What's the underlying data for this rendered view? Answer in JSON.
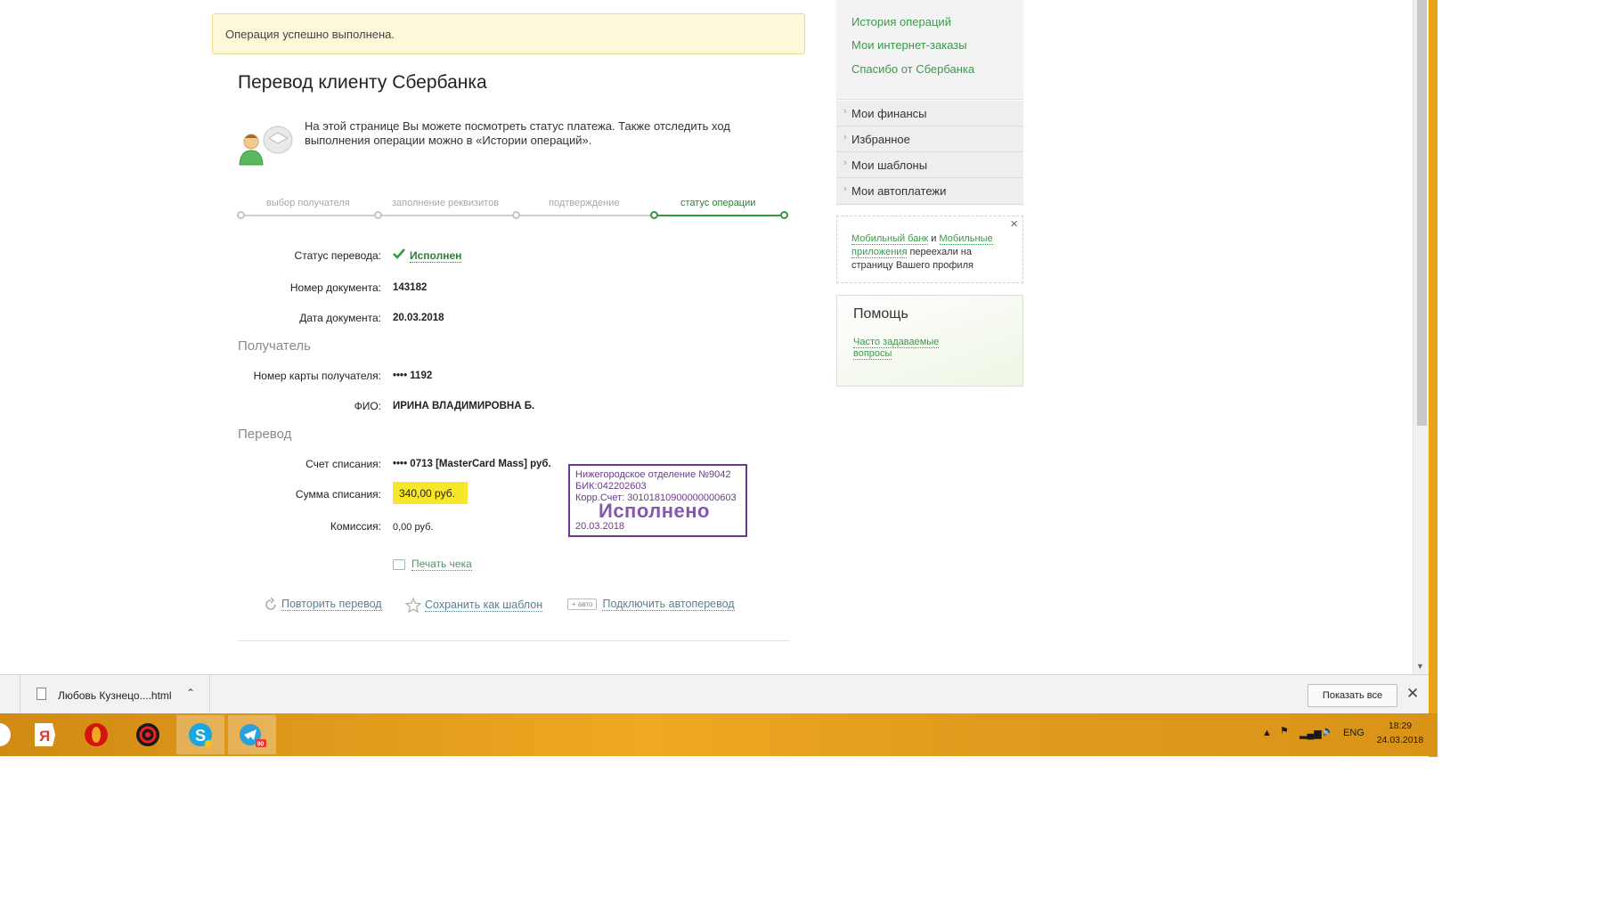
{
  "notification": {
    "text": "Операция успешно выполнена."
  },
  "page": {
    "title": "Перевод клиенту Сбербанка",
    "intro": "На этой странице Вы можете посмотреть статус платежа. Также отследить ход выполнения операции можно в «Истории операций».",
    "steps": [
      {
        "label": "выбор получателя"
      },
      {
        "label": "заполнение реквизитов"
      },
      {
        "label": "подтверждение"
      },
      {
        "label": "статус операции"
      }
    ],
    "fields": {
      "status_label": "Статус перевода:",
      "status_value": "Исполнен",
      "doc_number_label": "Номер документа:",
      "doc_number_value": "143182",
      "doc_date_label": "Дата документа:",
      "doc_date_value": "20.03.2018"
    },
    "recipient": {
      "section": "Получатель",
      "card_label": "Номер карты получателя:",
      "card_value": "•••• 1192",
      "name_label": "ФИО:",
      "name_value": "ИРИНА ВЛАДИМИРОВНА Б."
    },
    "transfer": {
      "section": "Перевод",
      "account_label": "Счет списания:",
      "account_value": "•••• 0713  [MasterCard Mass]  руб.",
      "amount_label": "Сумма списания:",
      "amount_value": "340,00  руб.",
      "fee_label": "Комиссия:",
      "fee_value": "0,00 руб."
    },
    "stamp": {
      "line1": "Нижегородское отделение №9042",
      "line2": "БИК:042202603",
      "line3": "Корр.Счет: 30101810900000000603",
      "big": "Исполнено",
      "date": "20.03.2018"
    },
    "print_label": "Печать чека",
    "actions": {
      "repeat": "Повторить перевод",
      "save_template": "Сохранить как шаблон",
      "auto_badge": "+ авто",
      "autopay": "Подключить автоперевод"
    }
  },
  "sidebar": {
    "links": [
      "История операций",
      "Мои интернет-заказы",
      "Спасибо от Сбербанка"
    ],
    "menu": [
      "Мои финансы",
      "Избранное",
      "Мои шаблоны",
      "Мои автоплатежи"
    ],
    "notice": {
      "link1": "Мобильный банк",
      "and": " и ",
      "link2": "Мобильные приложения",
      "rest": " переехали на страницу Вашего профиля"
    },
    "help": {
      "title": "Помощь",
      "link": "Часто задаваемые вопросы"
    }
  },
  "download_bar": {
    "file_name": "Любовь Кузнецо....html",
    "show_all": "Показать все"
  },
  "taskbar": {
    "apps": [
      "yandex-browser",
      "opera",
      "antivirus",
      "skype",
      "telegram"
    ],
    "telegram_badge": "90",
    "lang": "ENG",
    "time": "18:29",
    "date": "24.03.2018"
  },
  "colors": {
    "sber_green": "#2f9a3c",
    "highlight_yellow": "#f8e628",
    "stamp_purple": "#6b3a8a",
    "taskbar_orange": "#f0a822"
  }
}
